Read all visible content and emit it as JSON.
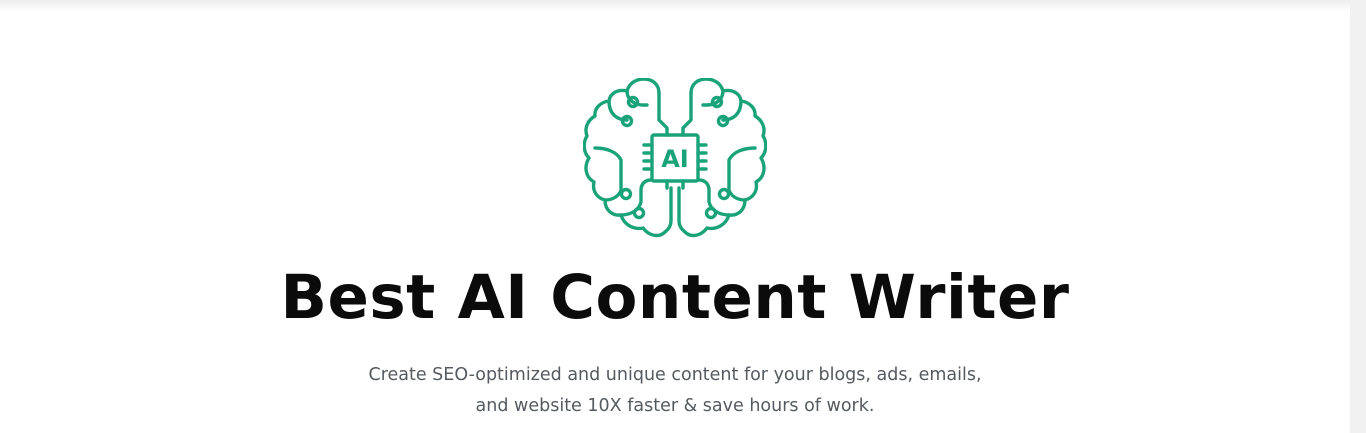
{
  "hero": {
    "title": "Best AI Content Writer",
    "subtitle_line1": "Create SEO-optimized and unique content for your blogs, ads, emails,",
    "subtitle_line2": "and website 10X faster & save hours of work.",
    "logo_chip_text": "AI",
    "logo_icon": "ai-brain-icon"
  },
  "colors": {
    "accent": "#1aa37a",
    "title": "#0b0b0b",
    "subtitle": "#555a60",
    "background": "#ffffff",
    "scrollbar_track": "#f1f1f1"
  }
}
